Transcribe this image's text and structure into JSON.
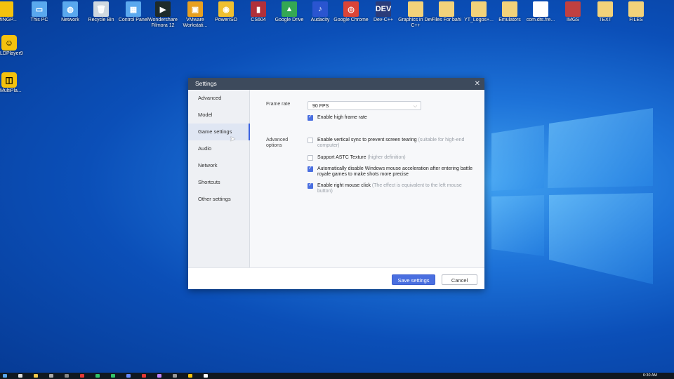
{
  "desktop": {
    "icons": [
      {
        "label": "LMINGP...",
        "color": "#f4c20d",
        "glyph": ""
      },
      {
        "label": "This PC",
        "color": "#5aa8ee",
        "glyph": "▭"
      },
      {
        "label": "Network",
        "color": "#5aa8ee",
        "glyph": "◍"
      },
      {
        "label": "Recycle Bin",
        "color": "#cfd8e0",
        "glyph": "🗑"
      },
      {
        "label": "Control Panel",
        "color": "#5aa8ee",
        "glyph": "▦"
      },
      {
        "label": "Wondershare Filmora 12",
        "color": "#1e2b2a",
        "glyph": "▶"
      },
      {
        "label": "VMware Workstati...",
        "color": "#e8a020",
        "glyph": "▣"
      },
      {
        "label": "PowerISO",
        "color": "#f0c030",
        "glyph": "◉"
      },
      {
        "label": "CS604",
        "color": "#b0303a",
        "glyph": "▮"
      },
      {
        "label": "Google Drive",
        "color": "#34a853",
        "glyph": "▲"
      },
      {
        "label": "Audacity",
        "color": "#2a55d0",
        "glyph": "♪"
      },
      {
        "label": "Google Chrome",
        "color": "#db4437",
        "glyph": "◎"
      },
      {
        "label": "Dev-C++",
        "color": "#2a3c7a",
        "glyph": "DEV"
      },
      {
        "label": "Graphics in Dev C++",
        "color": "#f2d27a",
        "glyph": ""
      },
      {
        "label": "Files For bahi",
        "color": "#f2d27a",
        "glyph": ""
      },
      {
        "label": "YT_Logos+...",
        "color": "#f2d27a",
        "glyph": ""
      },
      {
        "label": "Emulators",
        "color": "#f2d27a",
        "glyph": ""
      },
      {
        "label": "com.dts.fre...",
        "color": "#ffffff",
        "glyph": ""
      },
      {
        "label": "IMGS",
        "color": "#c04040",
        "glyph": ""
      },
      {
        "label": "TEXT",
        "color": "#f2d27a",
        "glyph": ""
      },
      {
        "label": "FILES",
        "color": "#f2d27a",
        "glyph": ""
      }
    ],
    "left_icons": [
      {
        "label": "LDPlayer9",
        "glyph": "☺"
      },
      {
        "label": "MultiPla...",
        "glyph": "◫"
      }
    ]
  },
  "dialog": {
    "title": "Settings",
    "close_glyph": "✕",
    "nav": [
      {
        "label": "Advanced",
        "active": false
      },
      {
        "label": "Model",
        "active": false
      },
      {
        "label": "Game settings",
        "active": true
      },
      {
        "label": "Audio",
        "active": false
      },
      {
        "label": "Network",
        "active": false
      },
      {
        "label": "Shortcuts",
        "active": false
      },
      {
        "label": "Other settings",
        "active": false
      }
    ],
    "frame_rate": {
      "label": "Frame rate",
      "selected": "90 FPS",
      "high_frame_rate": {
        "label": "Enable high frame rate",
        "checked": true
      }
    },
    "advanced_options": {
      "label": "Advanced options",
      "options": [
        {
          "label": "Enable vertical sync to prevent screen tearing",
          "hint": "(suitable for high-end computer)",
          "checked": false
        },
        {
          "label": "Support ASTC Texture",
          "hint": "(higher definition)",
          "checked": false
        },
        {
          "label": "Automatically disable Windows mouse acceleration after entering battle royale games to make shots more precise",
          "hint": "",
          "checked": true
        },
        {
          "label": "Enable right mouse click",
          "hint": "(The effect is equivalent to the left mouse button)",
          "checked": true
        }
      ]
    },
    "buttons": {
      "save": "Save settings",
      "cancel": "Cancel"
    }
  },
  "taskbar": {
    "time": "6:30 AM"
  },
  "colors": {
    "accent": "#4a6fe0",
    "title_bar": "#3d4a5c"
  }
}
